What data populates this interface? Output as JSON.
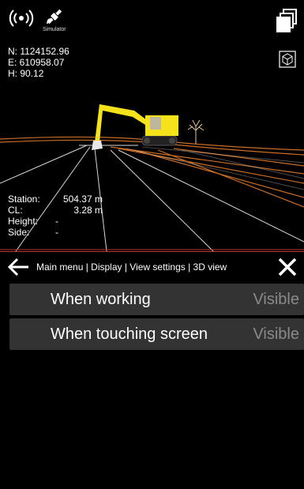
{
  "status": {
    "simulator_label": "Simulator"
  },
  "coordinates": {
    "n": "N: 1124152.96",
    "e": "E: 610958.07",
    "h": "H: 90.12"
  },
  "station_info": [
    {
      "label": "Station:",
      "value": "504.37 m"
    },
    {
      "label": "CL:",
      "value": "3.28 m"
    },
    {
      "label": "Height:",
      "value": "-"
    },
    {
      "label": "Side:",
      "value": "-"
    }
  ],
  "breadcrumb": "Main menu | Display | View settings | 3D view",
  "settings": [
    {
      "label": "When working",
      "value": "Visible"
    },
    {
      "label": "When touching screen",
      "value": "Visible"
    }
  ],
  "icons": [
    "gnss-signal-icon",
    "satellite-icon",
    "layers-icon",
    "cube-view-icon",
    "back-arrow-icon",
    "close-icon"
  ],
  "colors": {
    "excavator": "#f5e21a",
    "road_line": "#e07a2a",
    "divider": "#b33333",
    "row_bg": "#333333",
    "value_text": "#8a8a8a"
  }
}
